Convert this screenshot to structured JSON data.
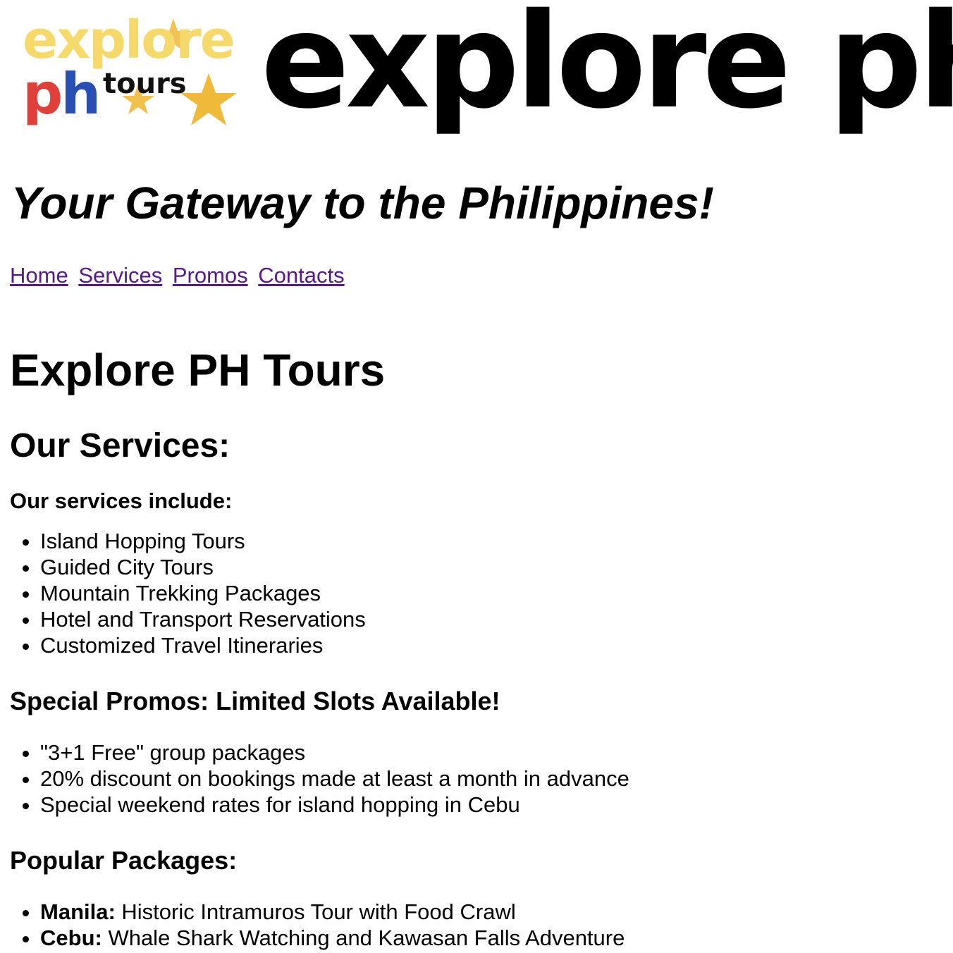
{
  "header": {
    "logo": {
      "word_top": "explore",
      "word_mid_left": "ph",
      "word_mid_right": "tours",
      "colors": {
        "explore": "#f5d96a",
        "ph_p": "#e0403a",
        "ph_h": "#2a4fb4",
        "tours": "#111111",
        "stars": "#efb93a"
      }
    },
    "wordmark": "explore ph"
  },
  "tagline": "Your Gateway to the Philippines!",
  "nav": {
    "items": [
      {
        "label": "Home"
      },
      {
        "label": "Services"
      },
      {
        "label": "Promos"
      },
      {
        "label": "Contacts"
      }
    ],
    "link_color": "#551a8b"
  },
  "main": {
    "title": "Explore PH Tours",
    "services": {
      "heading": "Our Services:",
      "intro": "Our services include:",
      "items": [
        "Island Hopping Tours",
        "Guided City Tours",
        "Mountain Trekking Packages",
        "Hotel and Transport Reservations",
        "Customized Travel Itineraries"
      ]
    },
    "promos": {
      "heading": "Special Promos: Limited Slots Available!",
      "items": [
        "\"3+1 Free\" group packages",
        "20% discount on bookings made at least a month in advance",
        "Special weekend rates for island hopping in Cebu"
      ]
    },
    "packages": {
      "heading": "Popular Packages:",
      "items": [
        {
          "place": "Manila:",
          "description": " Historic Intramuros Tour with Food Crawl"
        },
        {
          "place": "Cebu:",
          "description": " Whale Shark Watching and Kawasan Falls Adventure"
        }
      ]
    }
  }
}
